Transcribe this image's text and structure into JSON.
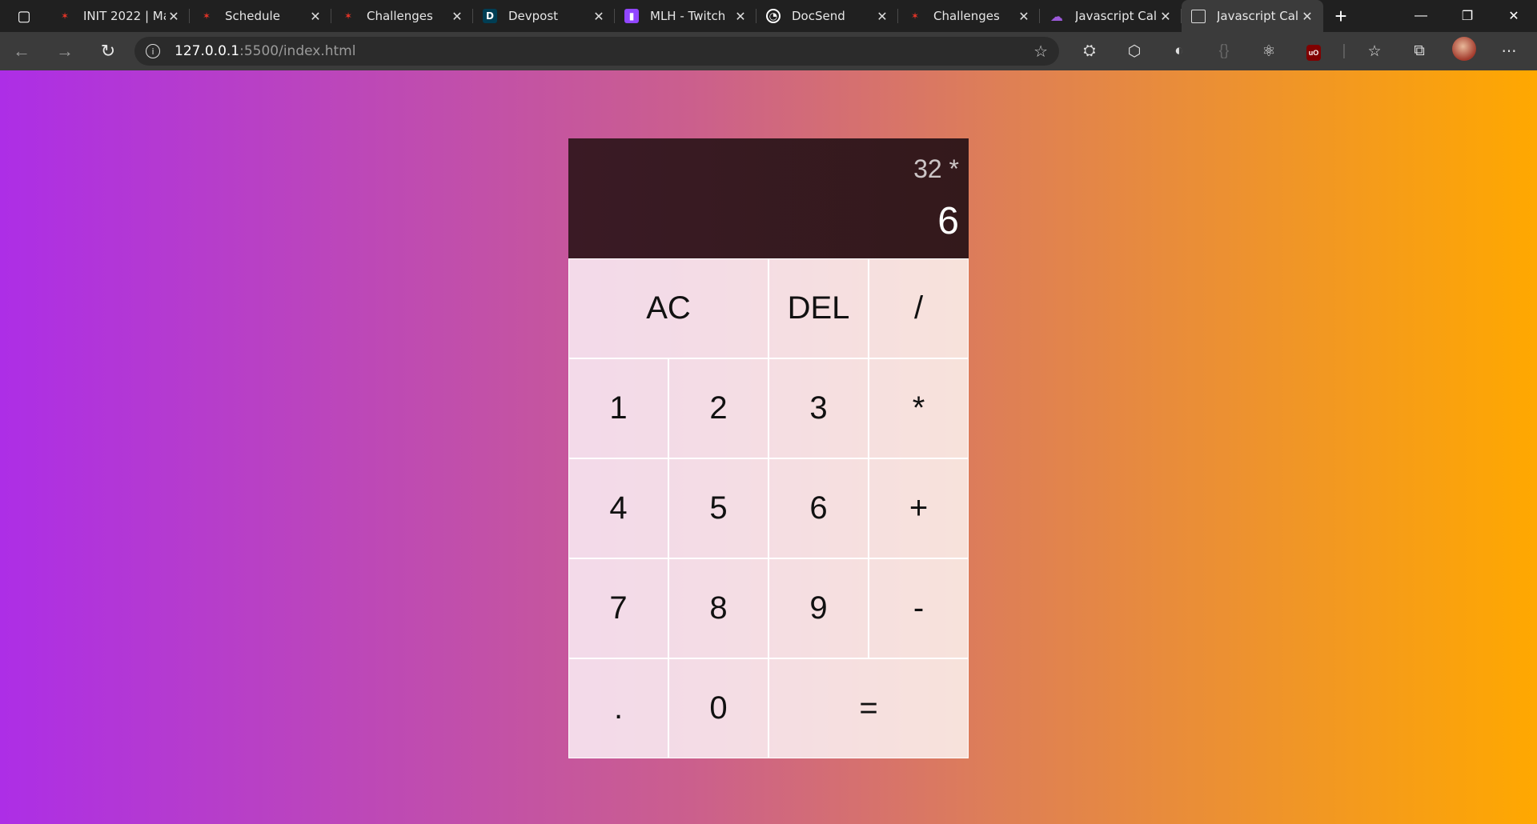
{
  "browser": {
    "tabs": [
      {
        "title": "INIT 2022 | Ma",
        "icon": "mlh-icon",
        "active": false
      },
      {
        "title": "Schedule",
        "icon": "mlh-icon",
        "active": false
      },
      {
        "title": "Challenges",
        "icon": "mlh-icon",
        "active": false
      },
      {
        "title": "Devpost",
        "icon": "devpost-icon",
        "active": false
      },
      {
        "title": "MLH - Twitch",
        "icon": "twitch-icon",
        "active": false
      },
      {
        "title": "DocSend",
        "icon": "docsend-icon",
        "active": false
      },
      {
        "title": "Challenges",
        "icon": "mlh-icon",
        "active": false
      },
      {
        "title": "Javascript Calc",
        "icon": "cloud-icon",
        "active": false
      },
      {
        "title": "Javascript Calc",
        "icon": "page-icon",
        "active": true
      }
    ],
    "url_host": "127.0.0.1",
    "url_path": ":5500/index.html"
  },
  "calculator": {
    "previous_operand": "32 *",
    "current_operand": "6",
    "keys": {
      "ac": "AC",
      "del": "DEL",
      "divide": "/",
      "one": "1",
      "two": "2",
      "three": "3",
      "multiply": "*",
      "four": "4",
      "five": "5",
      "six": "6",
      "plus": "+",
      "seven": "7",
      "eight": "8",
      "nine": "9",
      "minus": "-",
      "dot": ".",
      "zero": "0",
      "equals": "="
    }
  },
  "colors": {
    "gradient_start": "#ad2ee6",
    "gradient_end": "#ffa800",
    "display_bg": "#351a22"
  }
}
